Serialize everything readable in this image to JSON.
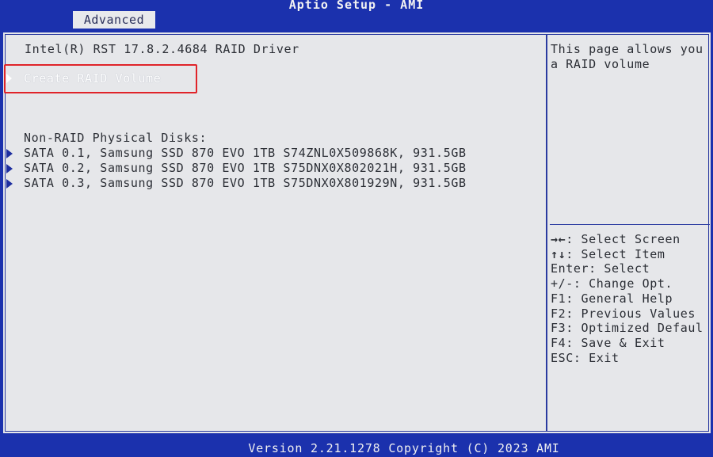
{
  "window": {
    "title": "Aptio Setup - AMI"
  },
  "tabs": [
    {
      "label": "Advanced",
      "active": true
    }
  ],
  "main": {
    "driver_title": "Intel(R) RST 17.8.2.4684 RAID Driver",
    "create_item": "Create RAID Volume",
    "non_raid_label": "Non-RAID Physical Disks:",
    "disks": [
      {
        "label": "SATA 0.1, Samsung SSD 870 EVO 1TB S74ZNL0X509868K, 931.5GB"
      },
      {
        "label": "SATA 0.2, Samsung SSD 870 EVO 1TB S75DNX0X802021H, 931.5GB"
      },
      {
        "label": "SATA 0.3, Samsung SSD 870 EVO 1TB S75DNX0X801929N, 931.5GB"
      }
    ]
  },
  "help": {
    "line1": "This page allows you",
    "line2": "a RAID volume"
  },
  "keys": [
    {
      "key": "→←",
      "desc": ": Select Screen"
    },
    {
      "key": "↑↓",
      "desc": ": Select Item"
    },
    {
      "key": "Enter",
      "desc": ": Select"
    },
    {
      "key": "+/-",
      "desc": ": Change Opt."
    },
    {
      "key": "F1",
      "desc": ": General Help"
    },
    {
      "key": "F2",
      "desc": ": Previous Values"
    },
    {
      "key": "F3",
      "desc": ": Optimized Defaul"
    },
    {
      "key": "F4",
      "desc": ": Save & Exit"
    },
    {
      "key": "ESC",
      "desc": ": Exit"
    }
  ],
  "footer": {
    "version": "Version 2.21.1278 Copyright (C) 2023 AMI"
  },
  "colors": {
    "background_blue": "#1b31ad",
    "panel_gray": "#e6e7ea",
    "highlight_red": "#e0242a",
    "selected_text": "#ffffff"
  }
}
